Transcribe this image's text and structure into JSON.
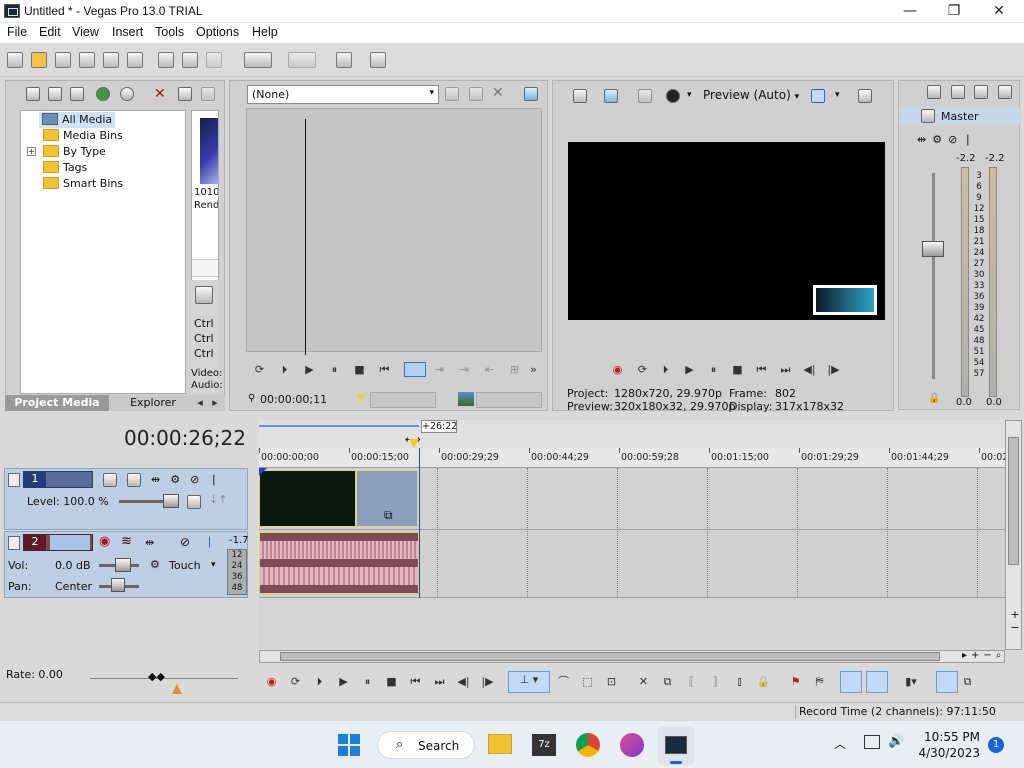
{
  "window": {
    "title": "Untitled * - Vegas Pro 13.0 TRIAL",
    "minimize": "—",
    "maximize": "❐",
    "close": "✕"
  },
  "menu": [
    "File",
    "Edit",
    "View",
    "Insert",
    "Tools",
    "Options",
    "Help"
  ],
  "project_media": {
    "tree": [
      "All Media",
      "Media Bins",
      "By Type",
      "Tags",
      "Smart Bins"
    ],
    "expander": "+",
    "thumb_caption": "1010 Rend",
    "side_labels": [
      "Ctrl",
      "Ctrl",
      "Ctrl"
    ],
    "video_label": "Video:",
    "audio_label": "Audio:",
    "tabs": [
      "Project Media",
      "Explorer"
    ]
  },
  "trimmer": {
    "dropdown_value": "(None)",
    "timecode": "00:00:00;11"
  },
  "preview": {
    "mode": "Preview (Auto)",
    "project_label": "Project:",
    "project_value": "1280x720, 29.970p",
    "preview_label": "Preview:",
    "preview_value": "320x180x32, 29.970p",
    "frame_label": "Frame:",
    "frame_value": "802",
    "display_label": "Display:",
    "display_value": "317x178x32",
    "watermark_text": "vegas"
  },
  "master": {
    "title": "Master",
    "peak_left": "-2.2",
    "peak_right": "-2.2",
    "scale": [
      "3",
      "6",
      "9",
      "12",
      "15",
      "18",
      "21",
      "24",
      "27",
      "30",
      "33",
      "36",
      "39",
      "42",
      "45",
      "48",
      "51",
      "54",
      "57"
    ],
    "bottom_left": "0.0",
    "bottom_right": "0.0"
  },
  "timeline": {
    "cursor_time": "00:00:26;22",
    "marker_label": "+26:22",
    "ruler": [
      "00:00:00;00",
      "00:00:15;00",
      "00:00:29;29",
      "00:00:44;29",
      "00:00:59;28",
      "00:01:15;00",
      "00:01:29;29",
      "00:01:44;29",
      "00:02:0"
    ],
    "cursor_fraction": 0.214
  },
  "tracks": {
    "video": {
      "number": "1",
      "level_label": "Level: 100.0 %",
      "level": 1.0
    },
    "audio": {
      "number": "2",
      "vol_label": "Vol:",
      "vol_value": "0.0 dB",
      "pan_label": "Pan:",
      "pan_value": "Center",
      "automation": "Touch",
      "meter_top": "-1.7",
      "meter_scale": [
        "12",
        "24",
        "36",
        "48"
      ]
    }
  },
  "transport": {
    "rate": "Rate: 0.00"
  },
  "status": {
    "record_time": "Record Time (2 channels): 97:11:50"
  },
  "taskbar": {
    "search": "Search",
    "time": "10:55 PM",
    "date": "4/30/2023",
    "notifications": "1"
  },
  "colors": {
    "accent": "#2a5bd7",
    "video_clip": "#0c1a12",
    "audio_clip": "#7d4d59",
    "cursor": "#1e4fa8"
  }
}
